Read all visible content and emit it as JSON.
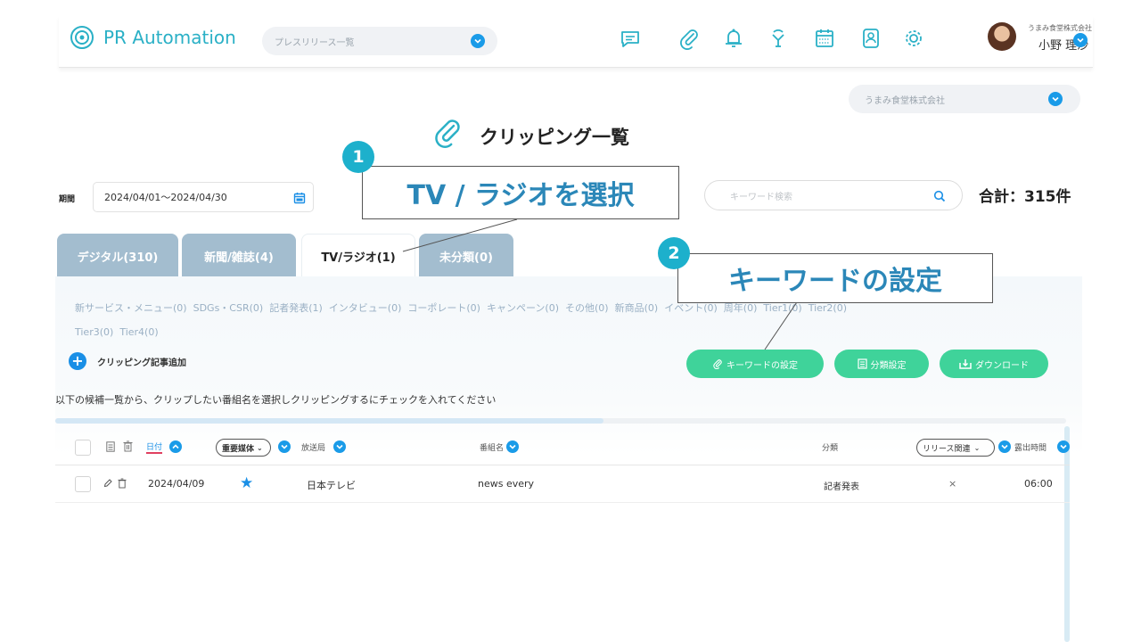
{
  "app": {
    "title": "PR Automation"
  },
  "header": {
    "release_select": "プレスリリース一覧",
    "company_small": "うまみ食堂株式会社",
    "user_name": "小野 理沙"
  },
  "company_select": "うまみ食堂株式会社",
  "page_title": "クリッピング一覧",
  "period": {
    "label": "期間",
    "value": "2024/04/01〜2024/04/30"
  },
  "search": {
    "placeholder": "キーワード検索"
  },
  "total": "合計：315件",
  "tabs": [
    {
      "label": "デジタル(310)",
      "active": false
    },
    {
      "label": "新聞/雑誌(4)",
      "active": false
    },
    {
      "label": "TV/ラジオ(1)",
      "active": true
    },
    {
      "label": "未分類(0)",
      "active": false
    }
  ],
  "categories_line1": [
    "新サービス・メニュー(0)",
    "SDGs・CSR(0)",
    "記者発表(1)",
    "インタビュー(0)",
    "コーポレート(0)",
    "キャンペーン(0)",
    "その他(0)",
    "新商品(0)",
    "イベント(0)",
    "周年(0)",
    "Tier1(0)",
    "Tier2(0)"
  ],
  "categories_line2": [
    "Tier3(0)",
    "Tier4(0)"
  ],
  "actions": {
    "add_clipping": "クリッピング記事追加",
    "keyword_settings": "キーワードの設定",
    "category_settings": "分類設定",
    "download": "ダウンロード"
  },
  "instruction": "以下の候補一覧から、クリップしたい番組名を選択しクリッピングするにチェックを入れてください",
  "table": {
    "headers": {
      "date": "日付",
      "important_media": "重要媒体",
      "station": "放送局",
      "program": "番組名",
      "category": "分類",
      "release_related": "リリース関連",
      "air_time": "露出時間"
    },
    "rows": [
      {
        "date": "2024/04/09",
        "important": "★",
        "station": "日本テレビ",
        "program": "news every",
        "category": "記者発表",
        "release_related": "×",
        "air_time": "06:00"
      }
    ]
  },
  "callouts": [
    {
      "number": "1",
      "text": "TV / ラジオを選択"
    },
    {
      "number": "2",
      "text": "キーワードの設定"
    }
  ],
  "colors": {
    "brand": "#2ab0c6",
    "tab_inactive": "#a3bdcf",
    "green_button": "#3fd39a",
    "accent_blue": "#1a9be8"
  }
}
